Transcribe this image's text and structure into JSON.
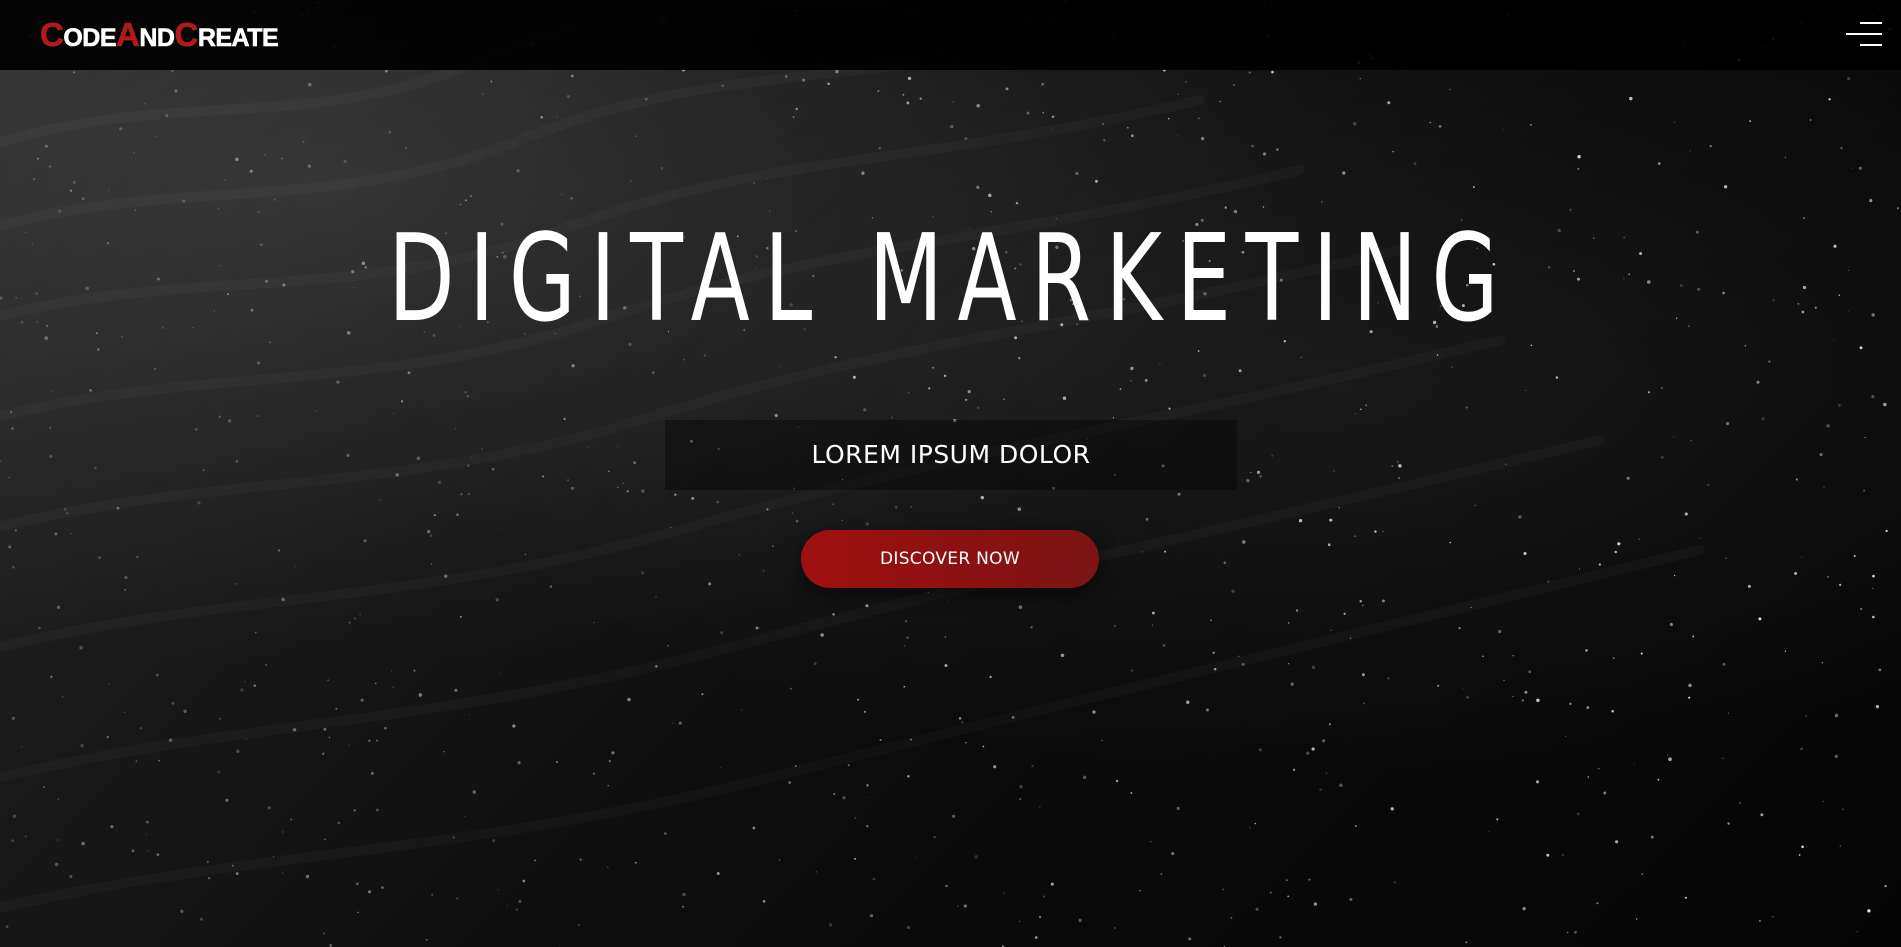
{
  "header": {
    "logo": {
      "parts": [
        {
          "cap": "C",
          "rest": "ODE"
        },
        {
          "cap": "A",
          "rest": "ND"
        },
        {
          "cap": "C",
          "rest": "REATE"
        }
      ]
    },
    "menu_icon": "hamburger-menu-icon"
  },
  "hero": {
    "title": "DIGITAL MARKETING",
    "subtitle": "LOREM IPSUM DOLOR",
    "cta_label": "DISCOVER NOW"
  },
  "colors": {
    "accent": "#9b1212",
    "logo_accent": "#b01a1a",
    "text": "#ffffff",
    "navbar_bg": "#000000"
  }
}
